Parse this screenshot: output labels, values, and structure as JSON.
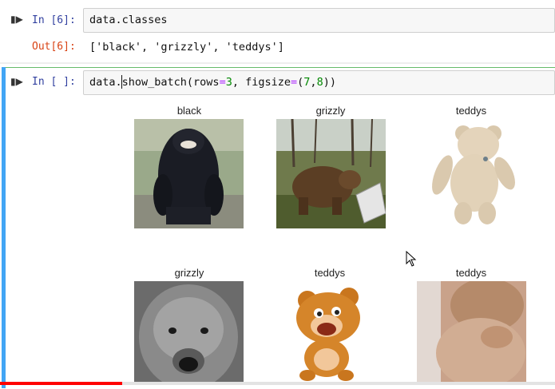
{
  "cells": [
    {
      "run_icon": "step-run-icon",
      "in_prompt": "In [6]:",
      "code": "data.classes",
      "out_prompt": "Out[6]:",
      "output": "['black', 'grizzly', 'teddys']"
    },
    {
      "run_icon": "step-run-icon",
      "in_prompt": "In [ ]:",
      "code_parts": {
        "obj": "data.",
        "fn": "show_batch(rows",
        "eq1": "=",
        "n1": "3",
        "mid": ", figsize",
        "eq2": "=",
        "tuple_open": "(",
        "n2": "7",
        "comma": ",",
        "n3": "8",
        "tuple_close": "))"
      }
    }
  ],
  "batch_grid": [
    {
      "label": "black",
      "subject": "black-bear-photo"
    },
    {
      "label": "grizzly",
      "subject": "grizzly-bear-photo"
    },
    {
      "label": "teddys",
      "subject": "teddy-bear-photo"
    },
    {
      "label": "grizzly",
      "subject": "grizzly-face-bw-photo"
    },
    {
      "label": "teddys",
      "subject": "cartoon-teddy-bear"
    },
    {
      "label": "teddys",
      "subject": "plush-teddy-closeup-photo"
    }
  ],
  "video_progress": 0.22,
  "colors": {
    "in_prompt": "#303F9F",
    "out_prompt": "#D84315",
    "selected_cell_bar": "#42A5F5",
    "progress": "#ff0000"
  }
}
